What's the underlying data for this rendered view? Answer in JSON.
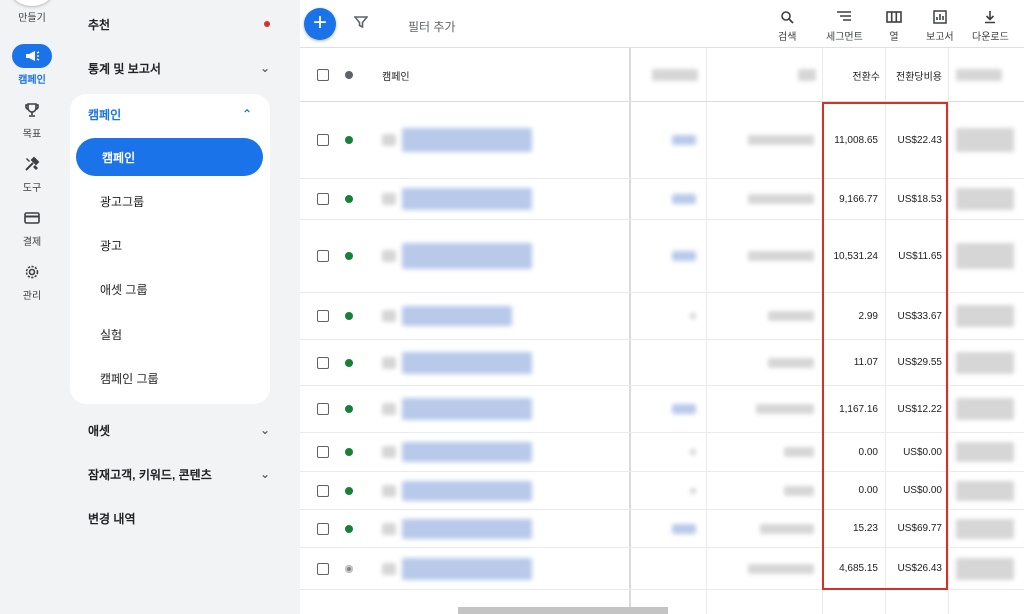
{
  "rail": {
    "items": [
      {
        "label": "만들기",
        "icon": "plus-icon"
      },
      {
        "label": "캠페인",
        "icon": "megaphone-icon",
        "active": true
      },
      {
        "label": "목표",
        "icon": "trophy-icon"
      },
      {
        "label": "도구",
        "icon": "tools-icon"
      },
      {
        "label": "결제",
        "icon": "credit-card-icon"
      },
      {
        "label": "관리",
        "icon": "gear-icon"
      }
    ]
  },
  "nav": {
    "recommend": "추천",
    "stats": "통계 및 보고서",
    "campaign_section": "캠페인",
    "sub_items": [
      "캠페인",
      "광고그룹",
      "광고",
      "애셋 그룹",
      "실험",
      "캠페인 그룹"
    ],
    "assets": "애셋",
    "audience": "잠재고객, 키워드, 콘텐츠",
    "history": "변경 내역"
  },
  "toolbar": {
    "filter_add": "필터 추가",
    "search": "검색",
    "segment": "세그먼트",
    "columns": "열",
    "report": "보고서",
    "download": "다운로드"
  },
  "table": {
    "headers": {
      "campaign": "캠페인",
      "conversions": "전환수",
      "cost_per_conversion": "전환당비용"
    },
    "rows": [
      {
        "status": "enabled",
        "conversions": "11,008.65",
        "cost": "US$22.43"
      },
      {
        "status": "enabled",
        "conversions": "9,166.77",
        "cost": "US$18.53"
      },
      {
        "status": "enabled",
        "conversions": "10,531.24",
        "cost": "US$11.65"
      },
      {
        "status": "enabled",
        "conversions": "2.99",
        "cost": "US$33.67"
      },
      {
        "status": "enabled",
        "conversions": "11.07",
        "cost": "US$29.55"
      },
      {
        "status": "enabled",
        "conversions": "1,167.16",
        "cost": "US$12.22"
      },
      {
        "status": "enabled",
        "conversions": "0.00",
        "cost": "US$0.00"
      },
      {
        "status": "enabled",
        "conversions": "0.00",
        "cost": "US$0.00"
      },
      {
        "status": "enabled",
        "conversions": "15.23",
        "cost": "US$69.77"
      },
      {
        "status": "paused",
        "conversions": "4,685.15",
        "cost": "US$26.43"
      }
    ]
  },
  "colors": {
    "accent": "#1a73e8",
    "enabled": "#188038",
    "paused": "#80868b",
    "highlight": "#d93025"
  }
}
